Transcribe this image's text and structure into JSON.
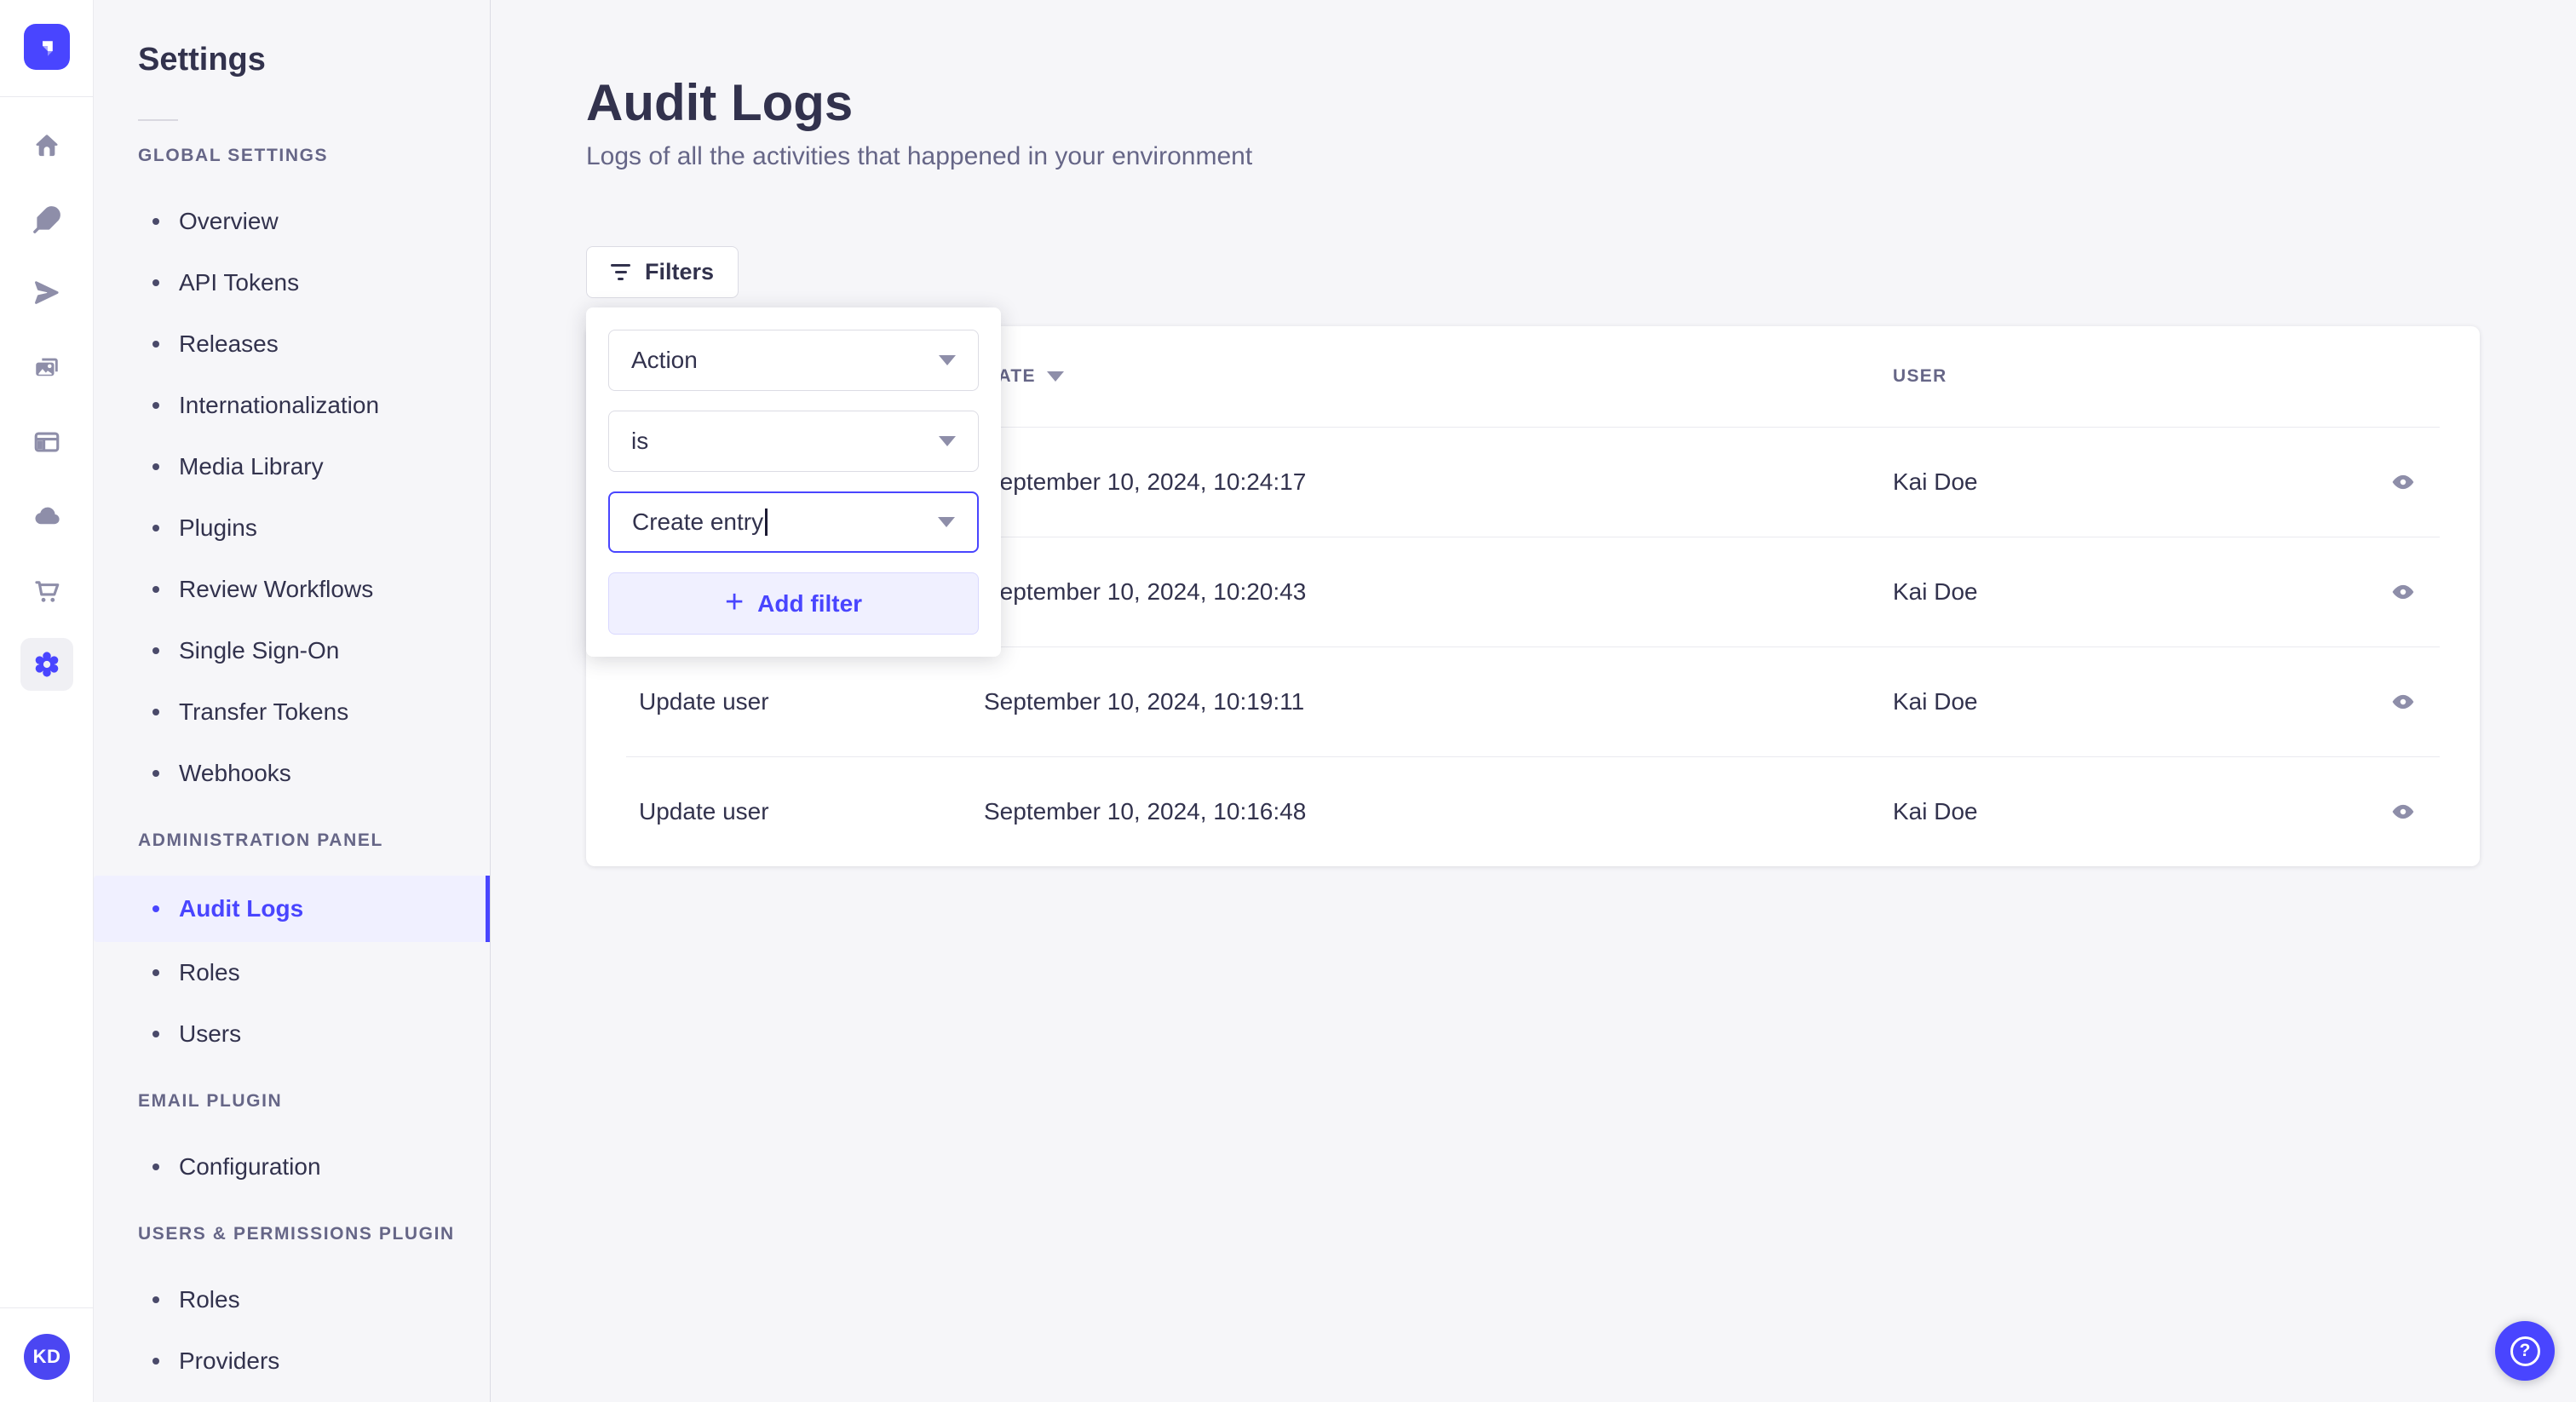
{
  "colors": {
    "primary": "#4945ff",
    "primary_bg": "#f0f0ff",
    "text": "#32324d",
    "text_subtle": "#666687",
    "icon_gray": "#8e8ea9",
    "border": "#dcdce4",
    "divider": "#eaeaef",
    "app_bg": "#f6f6f9",
    "surface": "#ffffff"
  },
  "icon_rail": {
    "logo_icon": "strapi-logo",
    "icons": [
      "home",
      "feather-content",
      "paper-plane",
      "media-library",
      "layout",
      "cloud",
      "marketplace-cart",
      "settings-gear-active"
    ],
    "avatar_initials": "KD"
  },
  "settings_nav": {
    "title": "Settings",
    "sections": [
      {
        "label": "GLOBAL SETTINGS",
        "items": [
          {
            "label": "Overview"
          },
          {
            "label": "API Tokens"
          },
          {
            "label": "Releases"
          },
          {
            "label": "Internationalization"
          },
          {
            "label": "Media Library"
          },
          {
            "label": "Plugins"
          },
          {
            "label": "Review Workflows"
          },
          {
            "label": "Single Sign-On"
          },
          {
            "label": "Transfer Tokens"
          },
          {
            "label": "Webhooks"
          }
        ]
      },
      {
        "label": "ADMINISTRATION PANEL",
        "items": [
          {
            "label": "Audit Logs",
            "active": true
          },
          {
            "label": "Roles"
          },
          {
            "label": "Users"
          }
        ]
      },
      {
        "label": "EMAIL PLUGIN",
        "items": [
          {
            "label": "Configuration"
          }
        ]
      },
      {
        "label": "USERS & PERMISSIONS PLUGIN",
        "items": [
          {
            "label": "Roles"
          },
          {
            "label": "Providers"
          }
        ]
      }
    ]
  },
  "main": {
    "title": "Audit Logs",
    "subtitle": "Logs of all the activities that happened in your environment",
    "filters_button_label": "Filters",
    "filter_popover": {
      "field_value": "Action",
      "operator_value": "is",
      "value_input": "Create entry",
      "add_filter_label": "Add filter",
      "plus_glyph": "+"
    },
    "table": {
      "columns": {
        "date": "DATE",
        "user": "USER"
      },
      "date_sort": "descending",
      "rows": [
        {
          "action": "",
          "date": "September 10, 2024, 10:24:17",
          "user": "Kai Doe"
        },
        {
          "action": "",
          "date": "September 10, 2024, 10:20:43",
          "user": "Kai Doe"
        },
        {
          "action": "Update user",
          "date": "September 10, 2024, 10:19:11",
          "user": "Kai Doe"
        },
        {
          "action": "Update user",
          "date": "September 10, 2024, 10:16:48",
          "user": "Kai Doe"
        }
      ]
    }
  },
  "help": {
    "glyph": "?"
  }
}
